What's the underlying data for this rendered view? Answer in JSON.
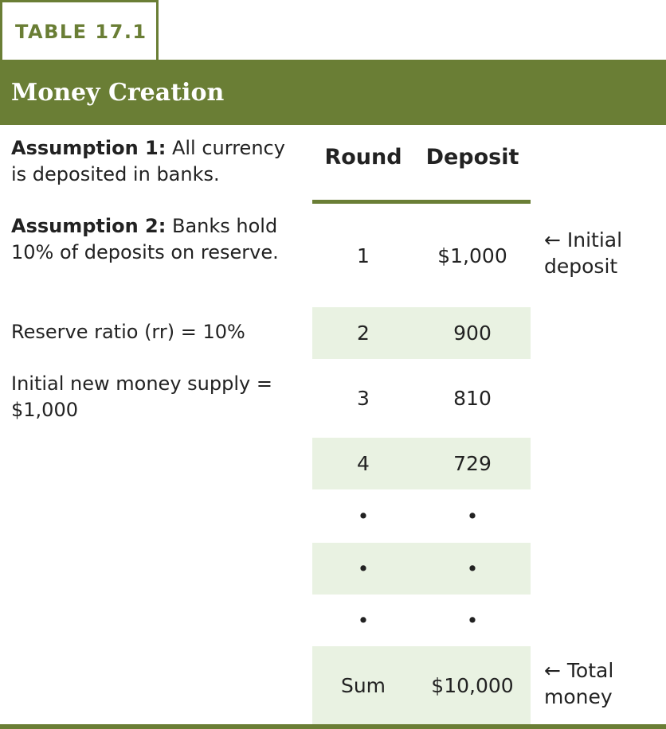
{
  "table_label": "TABLE 17.1",
  "title": "Money Creation",
  "assumptions": {
    "a1_bold": "Assumption 1:",
    "a1_text": " All currency is deposited in banks.",
    "a2_bold": "Assumption 2:",
    "a2_text": " Banks hold 10% of deposits on reserve.",
    "reserve_ratio": "Reserve ratio (rr) = 10%",
    "initial_money": "Initial new money supply = $1,000"
  },
  "table": {
    "headers": {
      "round": "Round",
      "deposit": "Deposit"
    },
    "rows": [
      {
        "round": "1",
        "deposit": "$1,000"
      },
      {
        "round": "2",
        "deposit": "900"
      },
      {
        "round": "3",
        "deposit": "810"
      },
      {
        "round": "4",
        "deposit": "729"
      },
      {
        "round": "•",
        "deposit": "•"
      },
      {
        "round": "•",
        "deposit": "•"
      },
      {
        "round": "•",
        "deposit": "•"
      },
      {
        "round": "Sum",
        "deposit": "$10,000"
      }
    ]
  },
  "notes": {
    "initial_line1": "← Initial",
    "initial_line2": "deposit",
    "total_line1": "← Total",
    "total_line2": "money"
  }
}
